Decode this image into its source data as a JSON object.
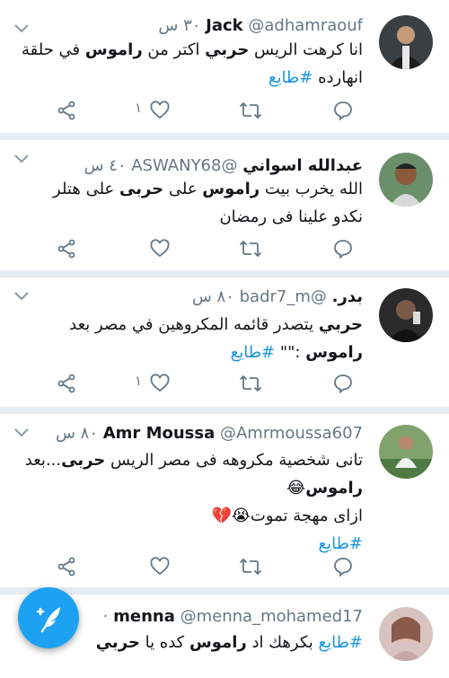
{
  "colors": {
    "accent": "#1da1f2",
    "hashtag": "#1b95e0",
    "muted": "#657786",
    "separator": "#e6ecf0",
    "like_red": "#e0245e"
  },
  "tweets": [
    {
      "display_name": "Jack",
      "handle": "@adhamraouf",
      "time": "٣٠ س",
      "text": [
        [
          {
            "t": "انا كرهت الريس "
          },
          {
            "t": "حربي",
            "b": true
          },
          {
            "t": " اكتر من "
          },
          {
            "t": "راموس",
            "b": true
          },
          {
            "t": " في حلقة"
          }
        ],
        [
          {
            "t": "انهارده "
          },
          {
            "t": "#طايع",
            "tag": true
          }
        ]
      ],
      "like_count": "١",
      "icons": [
        "reply-icon",
        "retweet-icon",
        "like-icon",
        "share-icon"
      ]
    },
    {
      "display_name": "عبدالله اسواني",
      "handle": "@ASWANY68",
      "time": "٤٠ س",
      "text": [
        [
          {
            "t": "الله يخرب بيت  "
          },
          {
            "t": "راموس",
            "b": true
          },
          {
            "t": "  على "
          },
          {
            "t": "حربى",
            "b": true
          },
          {
            "t": " على هتلر"
          }
        ],
        [
          {
            "t": "نكدو  علينا فى رمضان"
          }
        ]
      ],
      "like_count": ""
    },
    {
      "display_name": "بدر.",
      "handle": "@badr7_m",
      "time": "٨٠ س",
      "text": [
        [
          {
            "t": "حربي",
            "b": true
          },
          {
            "t": " يتصدر قائمه المكروهين في مصر بعد"
          }
        ],
        [
          {
            "t": "راموس",
            "b": true
          },
          {
            "t": " :\"\" "
          },
          {
            "t": "#طايع",
            "tag": true
          }
        ]
      ],
      "like_count": "١"
    },
    {
      "display_name": "Amr Moussa",
      "handle": "@Amrmoussa607",
      "time": "٨٠ س",
      "text": [
        [
          {
            "t": "تانى شخصية مكروهه فى مصر الريس "
          },
          {
            "t": "حربى",
            "b": true
          },
          {
            "t": "...بعد"
          }
        ],
        [
          {
            "t": "راموس",
            "b": true
          },
          {
            "t": "😂"
          }
        ],
        [
          {
            "t": "ازاى مهجة تموت😭💔"
          }
        ],
        [
          {
            "t": "#طايع",
            "tag": true
          }
        ]
      ],
      "like_count": ""
    },
    {
      "display_name": "menna",
      "handle": "@menna_mohamed17",
      "time": "·",
      "text": [
        [
          {
            "t": "#طايع",
            "tag": true
          },
          {
            "t": " بكرهك اد "
          },
          {
            "t": "راموس",
            "b": true
          },
          {
            "t": " كده يا "
          },
          {
            "t": "حربي",
            "b": true
          }
        ]
      ]
    }
  ],
  "compose_button": {
    "icon": "compose-tweet-icon"
  }
}
